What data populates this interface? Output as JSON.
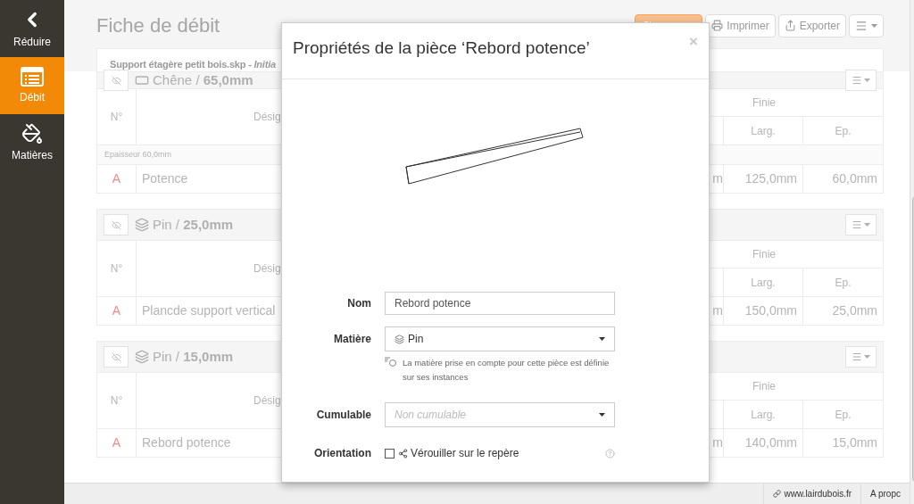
{
  "sidebar": {
    "items": [
      {
        "label": "Réduire",
        "kind": "collapse",
        "selected": false
      },
      {
        "label": "Débit",
        "kind": "cutlist",
        "selected": true
      },
      {
        "label": "Matières",
        "kind": "materials",
        "selected": false
      }
    ]
  },
  "header": {
    "title": "Fiche de débit",
    "buttons": [
      {
        "kind": "generate"
      },
      {
        "kind": "print",
        "label": "Imprimer"
      },
      {
        "kind": "export",
        "label": "Exporter"
      },
      {
        "kind": "menu"
      }
    ]
  },
  "file": {
    "name": "Support étagère petit bois.skp - ",
    "status": "Initia"
  },
  "groups": [
    {
      "kind": "board",
      "material": "Chêne",
      "separator": "/",
      "thickness": "65,0mm",
      "columns": {
        "number": "N°",
        "designation": "Désig",
        "finished": "Finie",
        "width": "Larg.",
        "thickness": "Ep."
      },
      "section": "Epaisseur 60,0mm",
      "rows": [
        {
          "number": "A",
          "name": "Potence",
          "column_3": "m",
          "width": "125,0mm",
          "thickness": "60,0mm"
        }
      ]
    },
    {
      "kind": "stack",
      "material": "Pin",
      "separator": "/",
      "thickness": "25,0mm",
      "columns": {
        "number": "N°",
        "designation": "Désig",
        "finished": "Finie",
        "width": "Larg.",
        "thickness": "Ep."
      },
      "rows": [
        {
          "number": "A",
          "name": "Plancde support vertical",
          "column_3": "m",
          "width": "150,0mm",
          "thickness": "25,0mm"
        }
      ]
    },
    {
      "kind": "stack",
      "material": "Pin",
      "separator": "/",
      "thickness": "15,0mm",
      "columns": {
        "number": "N°",
        "designation": "Désig",
        "finished": "Finie",
        "width": "Larg.",
        "thickness": "Ep."
      },
      "rows": [
        {
          "number": "A",
          "name": "Rebord potence",
          "column_3": "m",
          "width": "140,0mm",
          "thickness": "15,0mm"
        }
      ]
    }
  ],
  "modal": {
    "title": "Propriétés de la pièce ‘Rebord potence’",
    "close": "×",
    "fields": [
      {
        "kind": "text",
        "label": "Nom",
        "value": "Rebord potence"
      },
      {
        "kind": "select",
        "label": "Matière",
        "value": "Pin",
        "help": "La matière prise en compte pour cette pièce est définie sur ses instances"
      },
      {
        "kind": "select",
        "label": "Cumulable",
        "placeholder": "Non cumulable"
      },
      {
        "kind": "checkbox",
        "label": "Orientation",
        "checked": false,
        "text": "Vérouiller sur le repère"
      }
    ]
  },
  "footer": {
    "links": [
      "www.lairdubois.fr",
      "A propc"
    ]
  }
}
